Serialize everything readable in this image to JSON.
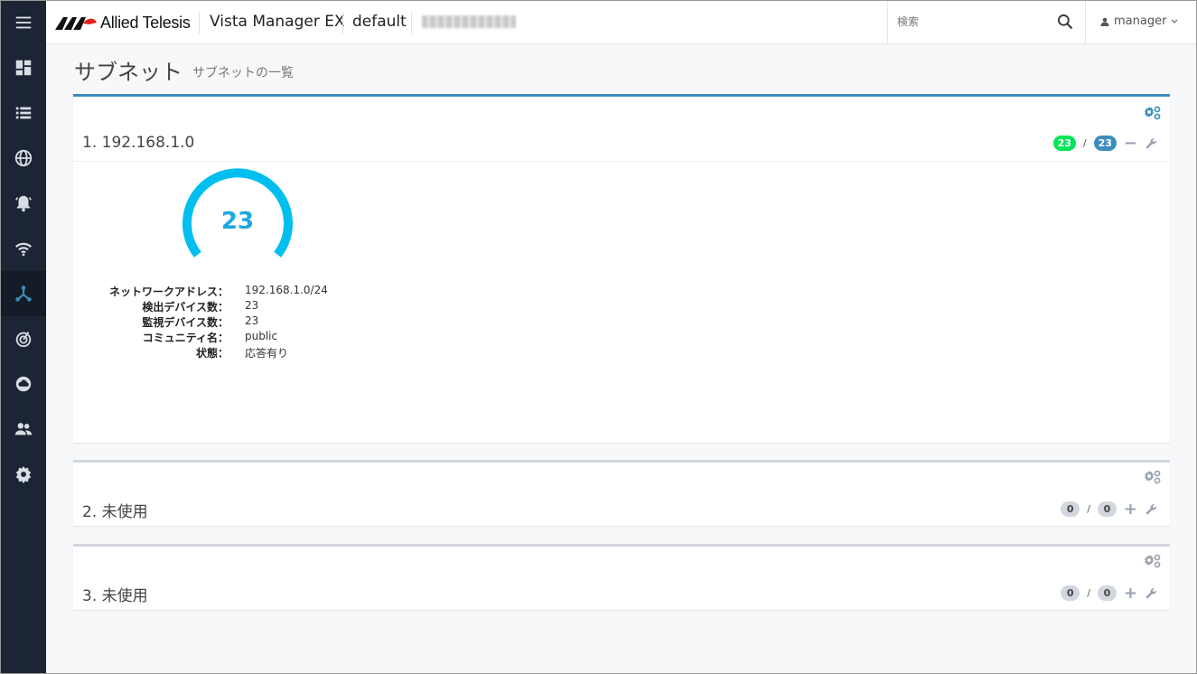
{
  "header": {
    "brand": "Allied Telesis",
    "product": "Vista Manager EX",
    "workspace": "default",
    "search_placeholder": "検索",
    "user": "manager"
  },
  "sidebar": {
    "items": [
      {
        "name": "menu",
        "icon": "hamburger-icon"
      },
      {
        "name": "dashboard",
        "icon": "dashboard-icon"
      },
      {
        "name": "list",
        "icon": "list-icon"
      },
      {
        "name": "globe",
        "icon": "globe-icon"
      },
      {
        "name": "alarm",
        "icon": "bell-icon"
      },
      {
        "name": "wireless",
        "icon": "wifi-icon"
      },
      {
        "name": "subnet",
        "icon": "network-icon",
        "active": true
      },
      {
        "name": "radar",
        "icon": "radar-icon"
      },
      {
        "name": "cloud",
        "icon": "cloud-icon"
      },
      {
        "name": "users",
        "icon": "users-icon"
      },
      {
        "name": "settings",
        "icon": "gear-icon"
      }
    ]
  },
  "page": {
    "title": "サブネット",
    "subtitle": "サブネットの一覧"
  },
  "panels": [
    {
      "title": "1. 192.168.1.0",
      "count_found": "23",
      "count_monitored": "23",
      "toggle": "−",
      "gauge": {
        "value": "23",
        "fraction": 1.0,
        "color": "#00bfef"
      },
      "info": {
        "labels": [
          "ネットワークアドレス：",
          "検出デバイス数：",
          "監視デバイス数：",
          "コミュニティ名：",
          "状態："
        ],
        "values": [
          "192.168.1.0/24",
          "23",
          "23",
          "public",
          "応答有り"
        ]
      }
    },
    {
      "title": "2. 未使用",
      "count_found": "0",
      "count_monitored": "0",
      "toggle": "+"
    },
    {
      "title": "3. 未使用",
      "count_found": "0",
      "count_monitored": "0",
      "toggle": "+"
    }
  ],
  "colors": {
    "sidebar_bg": "#1b2533",
    "primary_border": "#3c8dbc",
    "badge_green": "#00e55a",
    "badge_blue": "#3c8dbc",
    "gauge": "#00bfef"
  }
}
